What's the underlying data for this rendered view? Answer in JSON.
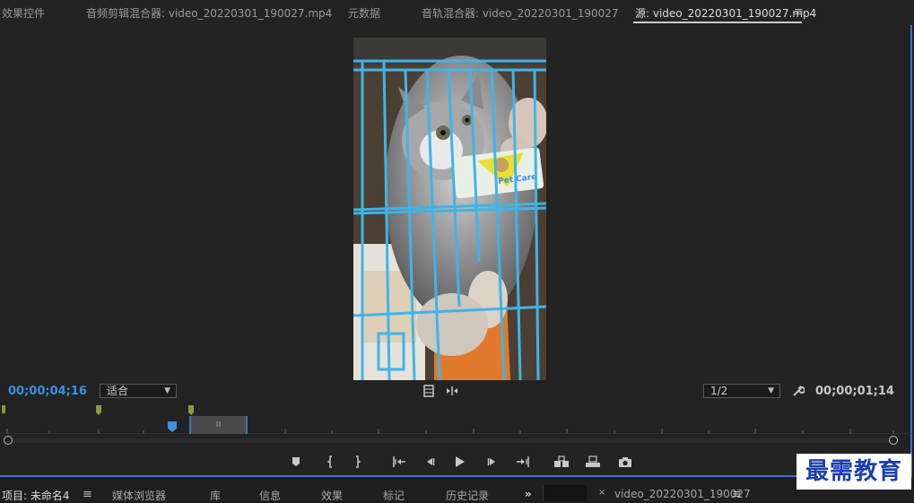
{
  "top_tabs": [
    {
      "label": "效果控件"
    },
    {
      "label": "音频剪辑混合器: video_20220301_190027.mp4"
    },
    {
      "label": "元数据"
    },
    {
      "label": "音轨混合器: video_20220301_190027"
    },
    {
      "label": "源: video_20220301_190027.mp4"
    }
  ],
  "source_monitor": {
    "timecode_current": "00;00;04;16",
    "zoom_select": "适合",
    "resolution_select": "1/2",
    "timecode_duration": "00;00;01;14",
    "video_sticker_text": "Pet Care"
  },
  "controls": [
    {
      "name": "add-marker-button",
      "icon": "marker"
    },
    {
      "name": "mark-in-button",
      "icon": "mark-in"
    },
    {
      "name": "mark-out-button",
      "icon": "mark-out"
    },
    {
      "name": "go-to-in-button",
      "icon": "go-to-in"
    },
    {
      "name": "step-back-button",
      "icon": "step-back"
    },
    {
      "name": "play-button",
      "icon": "play"
    },
    {
      "name": "step-forward-button",
      "icon": "step-forward"
    },
    {
      "name": "go-to-out-button",
      "icon": "go-to-out"
    },
    {
      "name": "insert-button",
      "icon": "insert"
    },
    {
      "name": "overwrite-button",
      "icon": "overwrite"
    },
    {
      "name": "export-frame-button",
      "icon": "camera"
    }
  ],
  "bottom_tabs": [
    {
      "label": "项目: 未命名4"
    },
    {
      "label": "媒体浏览器"
    },
    {
      "label": "库"
    },
    {
      "label": "信息"
    },
    {
      "label": "效果"
    },
    {
      "label": "标记"
    },
    {
      "label": "历史记录"
    },
    {
      "label": "video_20220301_190027"
    }
  ],
  "watermark": "最需教育",
  "colors": {
    "accent": "#3d8fe0",
    "panel_border": "#3a6fd8",
    "cage": "#3fb4ea"
  }
}
